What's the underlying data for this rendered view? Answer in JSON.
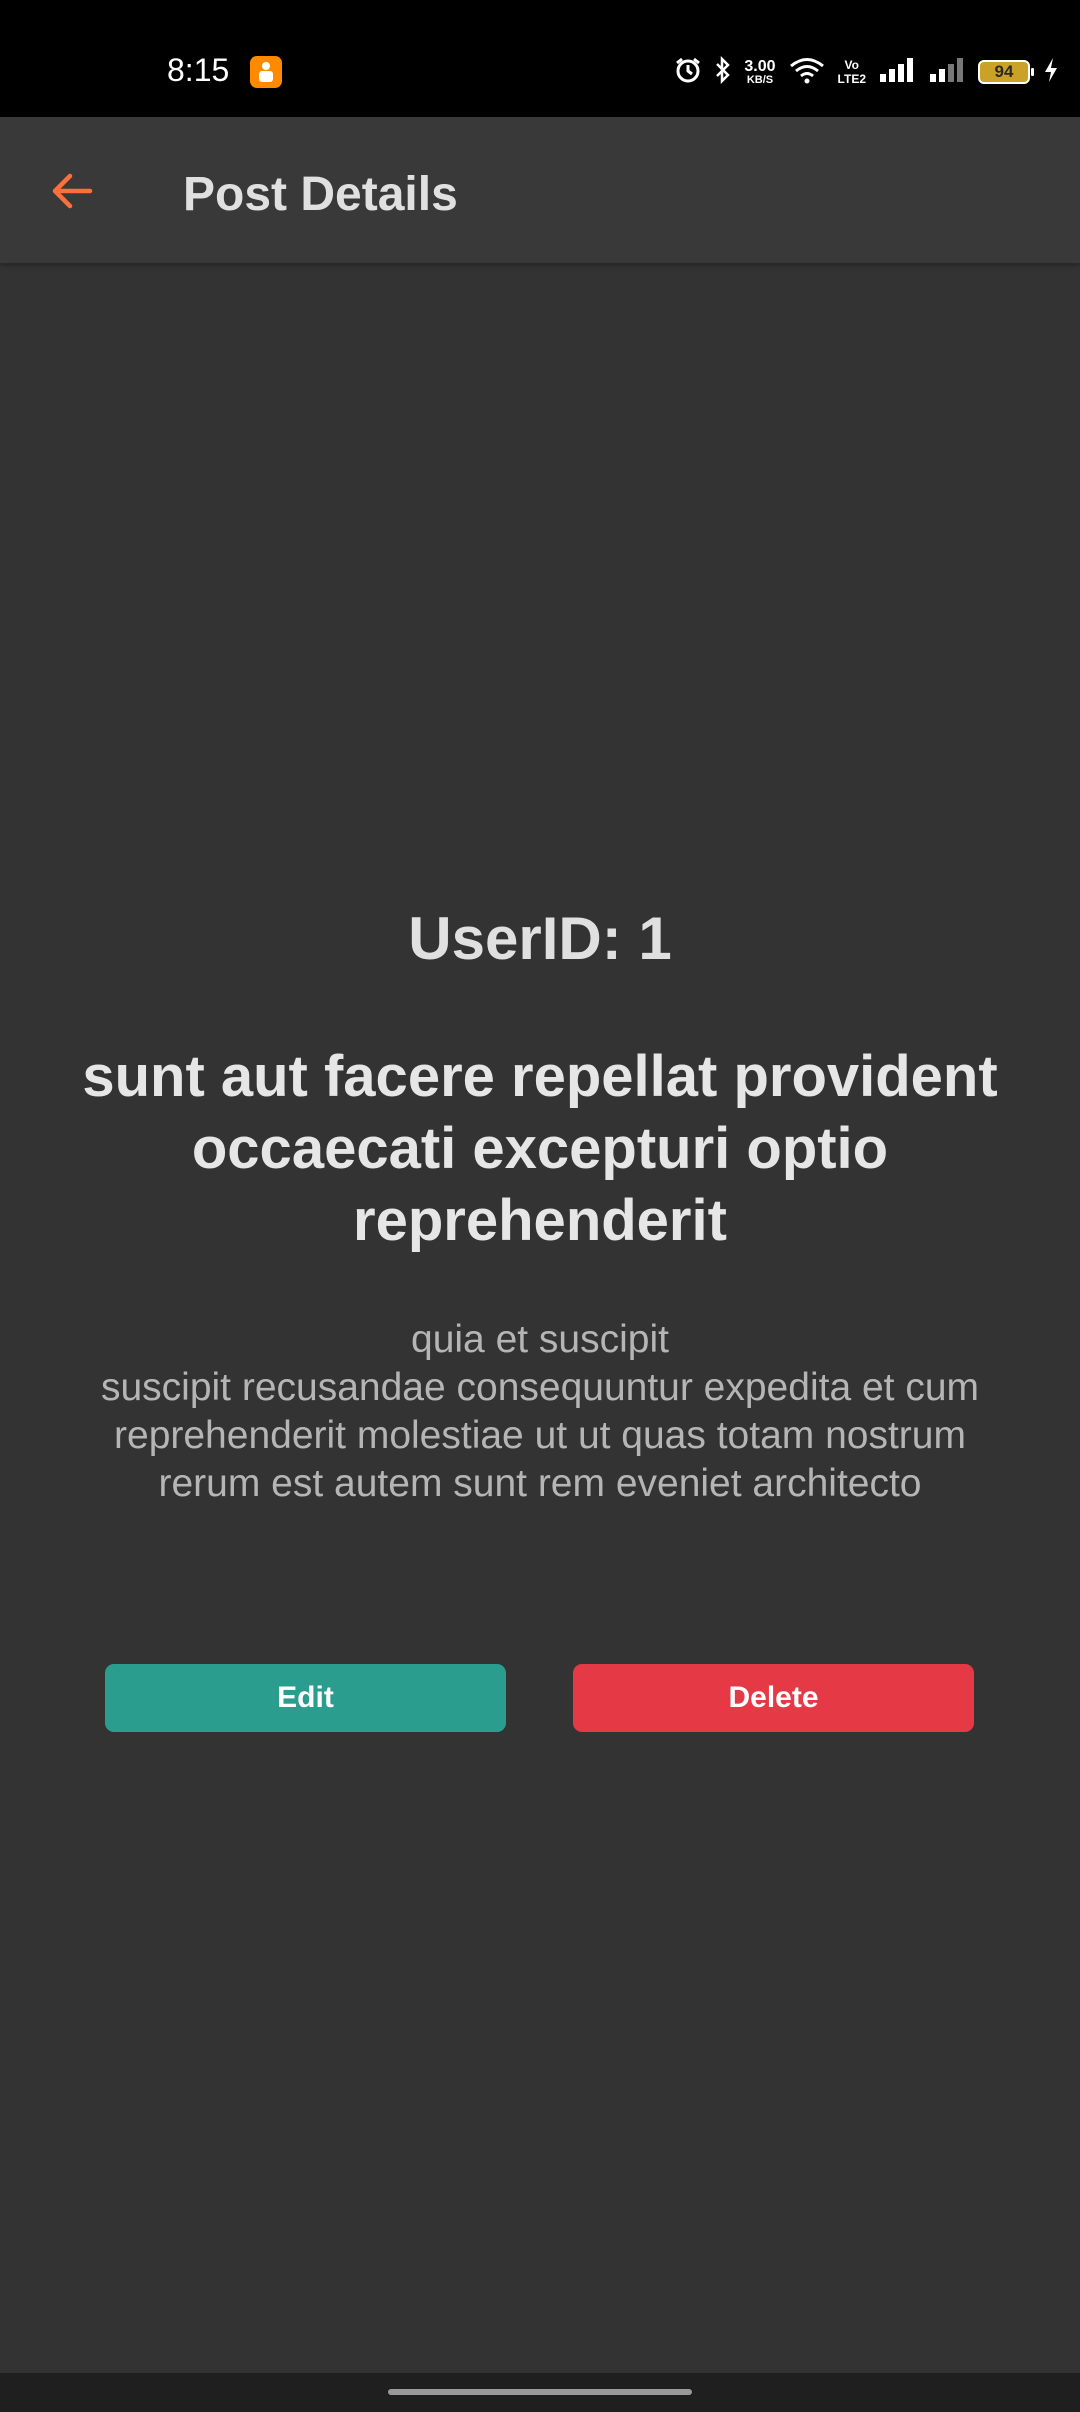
{
  "status_bar": {
    "time": "8:15",
    "network_speed": "3.00",
    "network_speed_unit": "KB/S",
    "volte_top": "Vo",
    "volte_bottom": "LTE2",
    "battery_level": "94",
    "icons": [
      "alarm-icon",
      "bluetooth-icon",
      "wifi-icon",
      "signal-icon",
      "signal-weak-icon",
      "charging-icon"
    ]
  },
  "app_bar": {
    "title": "Post Details",
    "back_icon": "arrow-left-icon",
    "accent_color": "#ff6f3c"
  },
  "post": {
    "user_id_label": "UserID: 1",
    "title": "sunt aut facere repellat provident occaecati excepturi optio reprehenderit",
    "body": "quia et suscipit\nsuscipit recusandae consequuntur expedita et cum reprehenderit molestiae ut ut quas totam nostrum rerum est autem sunt rem eveniet architecto"
  },
  "actions": {
    "edit_label": "Edit",
    "delete_label": "Delete",
    "edit_color": "#2a9d8f",
    "delete_color": "#e63946"
  }
}
